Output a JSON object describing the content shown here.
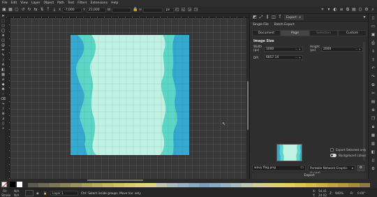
{
  "menu": [
    "File",
    "Edit",
    "View",
    "Layer",
    "Object",
    "Path",
    "Text",
    "Filters",
    "Extensions",
    "Help"
  ],
  "toolbar": {
    "x_label": "X",
    "x_value": "-7,000",
    "y_label": "Y",
    "y_value": "21,000",
    "w_label": "W",
    "h_label": "H",
    "unit": "px"
  },
  "panel": {
    "tabs": [
      {
        "label": "Export"
      }
    ],
    "subtabs": [
      "Single File",
      "Batch Export"
    ],
    "modes": [
      "Document",
      "Page",
      "Selection",
      "Custom"
    ],
    "active_mode": "Page",
    "image_size_title": "Image Size",
    "width_label": "Width (px)",
    "width_value": "1000",
    "height_label": "Height (px)",
    "height_value": "2000",
    "dpi_label": "DPI",
    "dpi_value": "6857.14",
    "export_selected_label": "Export Selected only",
    "background_label": "Background colour",
    "filename": "wavy flag.png",
    "format": "Portable Network Graphic (*.png)",
    "export_button": "Export"
  },
  "status": {
    "fill_label": "Fill",
    "fill_value": "N/A",
    "stroke_label": "Stroke",
    "stroke_value": "N/A",
    "layer": "Layer 1",
    "message": "Ctrl: Select inside groups, Move hor. only",
    "x_label": "X:",
    "x_value": "54.41",
    "y_label": "Y:",
    "y_value": "24.02",
    "zoom_label": "Z:",
    "zoom_value": "940%",
    "rotation_label": "R:",
    "rotation_value": "0.00°"
  },
  "colors": {
    "stripe_outer": "#35a9cf",
    "stripe_mid": "#5cd6c6",
    "stripe_center": "#bff2e2"
  }
}
